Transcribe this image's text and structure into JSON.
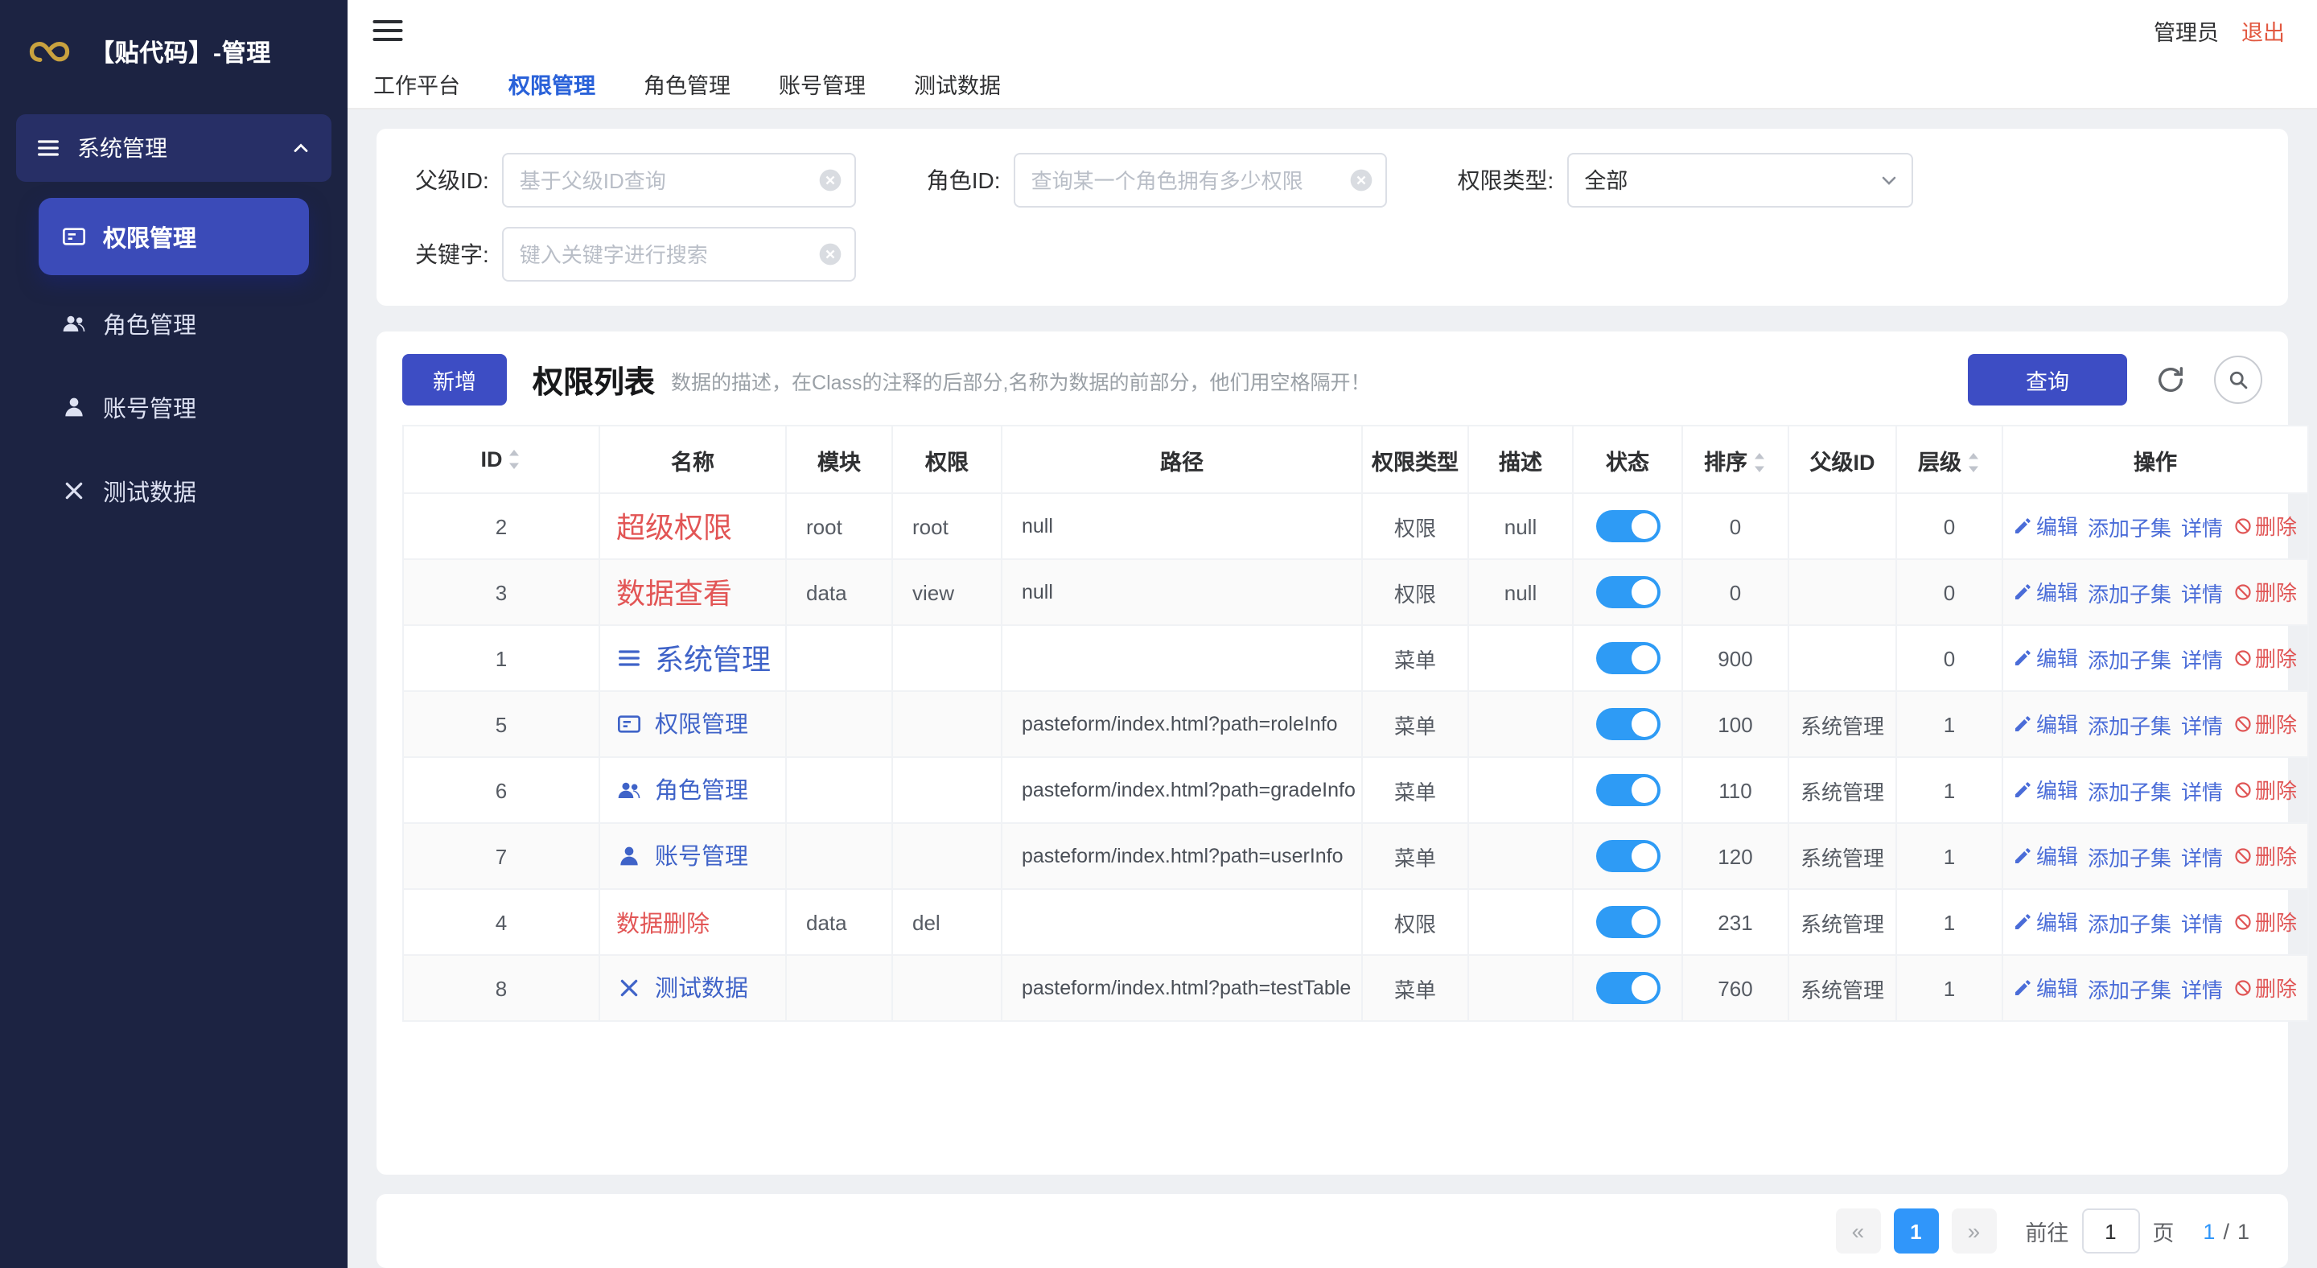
{
  "app": {
    "title": "【贴代码】-管理",
    "admin_label": "管理员",
    "logout_label": "退出"
  },
  "colors": {
    "sidebar_bg": "#1c2342",
    "sidebar_active": "#3b4bb8",
    "logo_gold": "#c9a23f",
    "primary_button": "#3d4dc4",
    "toggle_on": "#2e9bf5",
    "name_red": "#e25555",
    "name_blue": "#3f63c8",
    "link_blue": "#4a6cd8",
    "link_red": "#e05555",
    "logout_red": "#e25840",
    "active_tab": "#2a62d9",
    "active_page": "#3096fa"
  },
  "icons": {
    "logo": "gold-knot-swirl",
    "sidebar_group": "menu",
    "sidebar_items": [
      "id-card",
      "users",
      "user",
      "x"
    ],
    "toolbar": [
      "refresh",
      "magnifier"
    ],
    "ops": [
      "pencil",
      "",
      "",
      "ban"
    ]
  },
  "sidebar": {
    "group_label": "系统管理",
    "items": [
      {
        "label": "权限管理",
        "icon": "id-card",
        "active": true
      },
      {
        "label": "角色管理",
        "icon": "users",
        "active": false
      },
      {
        "label": "账号管理",
        "icon": "user",
        "active": false
      },
      {
        "label": "测试数据",
        "icon": "x",
        "active": false
      }
    ]
  },
  "tabs": [
    {
      "label": "工作平台",
      "active": false
    },
    {
      "label": "权限管理",
      "active": true
    },
    {
      "label": "角色管理",
      "active": false
    },
    {
      "label": "账号管理",
      "active": false
    },
    {
      "label": "测试数据",
      "active": false
    }
  ],
  "filters": {
    "parent_id": {
      "label": "父级ID:",
      "placeholder": "基于父级ID查询"
    },
    "role_id": {
      "label": "角色ID:",
      "placeholder": "查询某一个角色拥有多少权限"
    },
    "perm_type": {
      "label": "权限类型:",
      "value": "全部"
    },
    "keyword": {
      "label": "关键字:",
      "placeholder": "键入关键字进行搜索"
    }
  },
  "table_section": {
    "add_button": "新增",
    "title": "权限列表",
    "subtitle": "数据的描述，在Class的注释的后部分,名称为数据的前部分，他们用空格隔开！",
    "query_button": "查询"
  },
  "table": {
    "columns": [
      "ID",
      "名称",
      "模块",
      "权限",
      "路径",
      "权限类型",
      "描述",
      "状态",
      "排序",
      "父级ID",
      "层级",
      "操作"
    ],
    "sortable_columns": [
      "ID",
      "排序",
      "层级"
    ],
    "actions": [
      "编辑",
      "添加子集",
      "详情",
      "删除"
    ],
    "rows": [
      {
        "id": "2",
        "name": "超级权限",
        "name_color": "red",
        "name_size": "lg",
        "icon": "",
        "module": "root",
        "perm": "root",
        "path": "null",
        "type": "权限",
        "desc": "null",
        "status": true,
        "sort": "0",
        "parent": "",
        "level": "0"
      },
      {
        "id": "3",
        "name": "数据查看",
        "name_color": "red",
        "name_size": "lg",
        "icon": "",
        "module": "data",
        "perm": "view",
        "path": "null",
        "type": "权限",
        "desc": "null",
        "status": true,
        "sort": "0",
        "parent": "",
        "level": "0"
      },
      {
        "id": "1",
        "name": "系统管理",
        "name_color": "blue",
        "name_size": "lg",
        "icon": "menu",
        "module": "",
        "perm": "",
        "path": "",
        "type": "菜单",
        "desc": "",
        "status": true,
        "sort": "900",
        "parent": "",
        "level": "0"
      },
      {
        "id": "5",
        "name": "权限管理",
        "name_color": "blue",
        "name_size": "md",
        "icon": "card",
        "module": "",
        "perm": "",
        "path": "pasteform/index.html?path=roleInfo",
        "type": "菜单",
        "desc": "",
        "status": true,
        "sort": "100",
        "parent": "系统管理",
        "level": "1"
      },
      {
        "id": "6",
        "name": "角色管理",
        "name_color": "blue",
        "name_size": "md",
        "icon": "users",
        "module": "",
        "perm": "",
        "path": "pasteform/index.html?path=gradeInfo",
        "type": "菜单",
        "desc": "",
        "status": true,
        "sort": "110",
        "parent": "系统管理",
        "level": "1"
      },
      {
        "id": "7",
        "name": "账号管理",
        "name_color": "blue",
        "name_size": "md",
        "icon": "user",
        "module": "",
        "perm": "",
        "path": "pasteform/index.html?path=userInfo",
        "type": "菜单",
        "desc": "",
        "status": true,
        "sort": "120",
        "parent": "系统管理",
        "level": "1"
      },
      {
        "id": "4",
        "name": "数据删除",
        "name_color": "red",
        "name_size": "md",
        "icon": "",
        "module": "data",
        "perm": "del",
        "path": "",
        "type": "权限",
        "desc": "",
        "status": true,
        "sort": "231",
        "parent": "系统管理",
        "level": "1"
      },
      {
        "id": "8",
        "name": "测试数据",
        "name_color": "blue",
        "name_size": "md",
        "icon": "x",
        "module": "",
        "perm": "",
        "path": "pasteform/index.html?path=testTable",
        "type": "菜单",
        "desc": "",
        "status": true,
        "sort": "760",
        "parent": "系统管理",
        "level": "1"
      }
    ]
  },
  "pagination": {
    "prev_symbol": "«",
    "page": "1",
    "next_symbol": "»",
    "goto_label": "前往",
    "goto_value": "1",
    "page_unit": "页",
    "current": "1",
    "separator": "/",
    "total": "1"
  }
}
